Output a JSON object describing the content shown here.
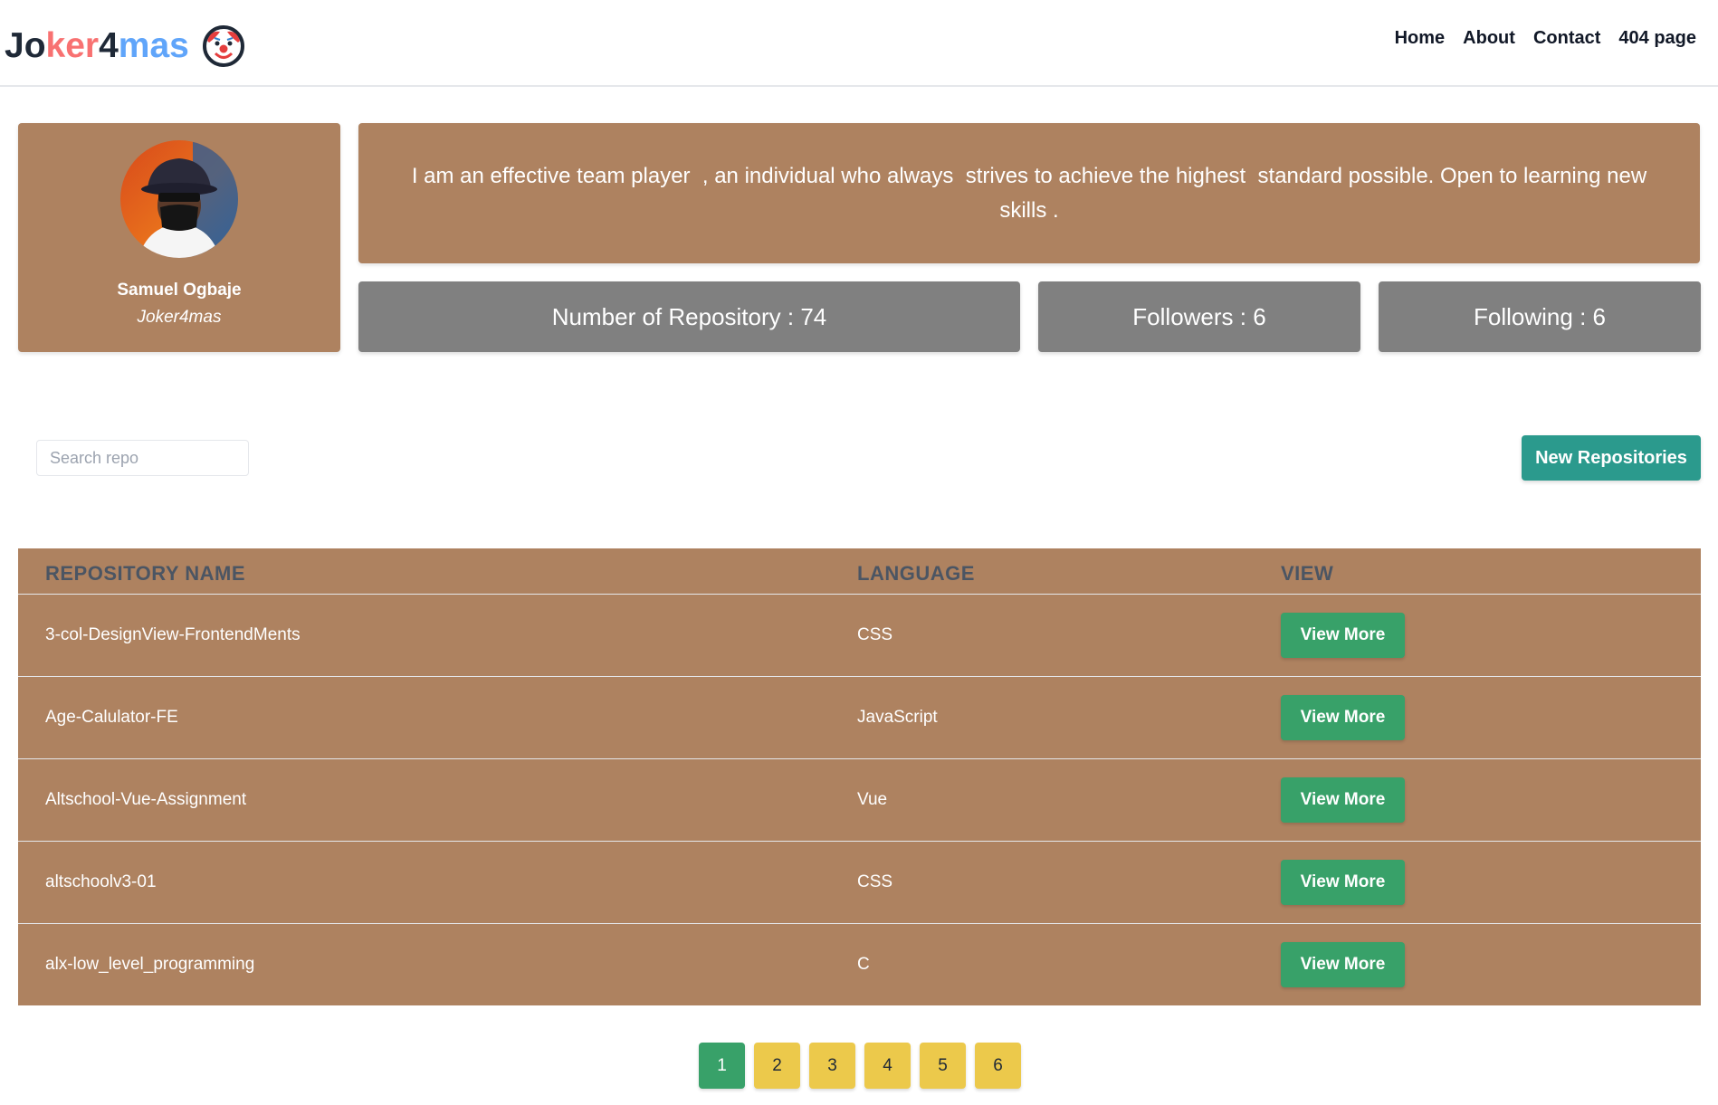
{
  "brand": {
    "part1": "Jo",
    "part2": "ker",
    "part3": "4",
    "part4": "mas"
  },
  "nav": [
    {
      "label": "Home"
    },
    {
      "label": "About"
    },
    {
      "label": "Contact"
    },
    {
      "label": "404 page"
    }
  ],
  "profile": {
    "name": "Samuel Ogbaje",
    "username": "Joker4mas",
    "bio": "I am an effective team player  , an individual who always  strives to achieve the highest  standard possible. Open to learning new skills ."
  },
  "stats": {
    "repos": "Number of Repository : 74",
    "followers": "Followers : 6",
    "following": "Following : 6"
  },
  "search": {
    "placeholder": "Search repo"
  },
  "new_repo_label": "New Repositories",
  "table": {
    "headers": [
      "Repository Name",
      "Language",
      "View"
    ],
    "rows": [
      {
        "name": "3-col-DesignView-FrontendMents",
        "language": "CSS",
        "action": "View More"
      },
      {
        "name": "Age-Calulator-FE",
        "language": "JavaScript",
        "action": "View More"
      },
      {
        "name": "Altschool-Vue-Assignment",
        "language": "Vue",
        "action": "View More"
      },
      {
        "name": "altschoolv3-01",
        "language": "CSS",
        "action": "View More"
      },
      {
        "name": "alx-low_level_programming",
        "language": "C",
        "action": "View More"
      }
    ]
  },
  "pagination": {
    "pages": [
      "1",
      "2",
      "3",
      "4",
      "5",
      "6"
    ],
    "current": "1"
  },
  "colors": {
    "card": "#ae8260",
    "stat": "#808080",
    "teal": "#2b9a8d",
    "green": "#38a169",
    "yellow": "#ecc94b"
  }
}
